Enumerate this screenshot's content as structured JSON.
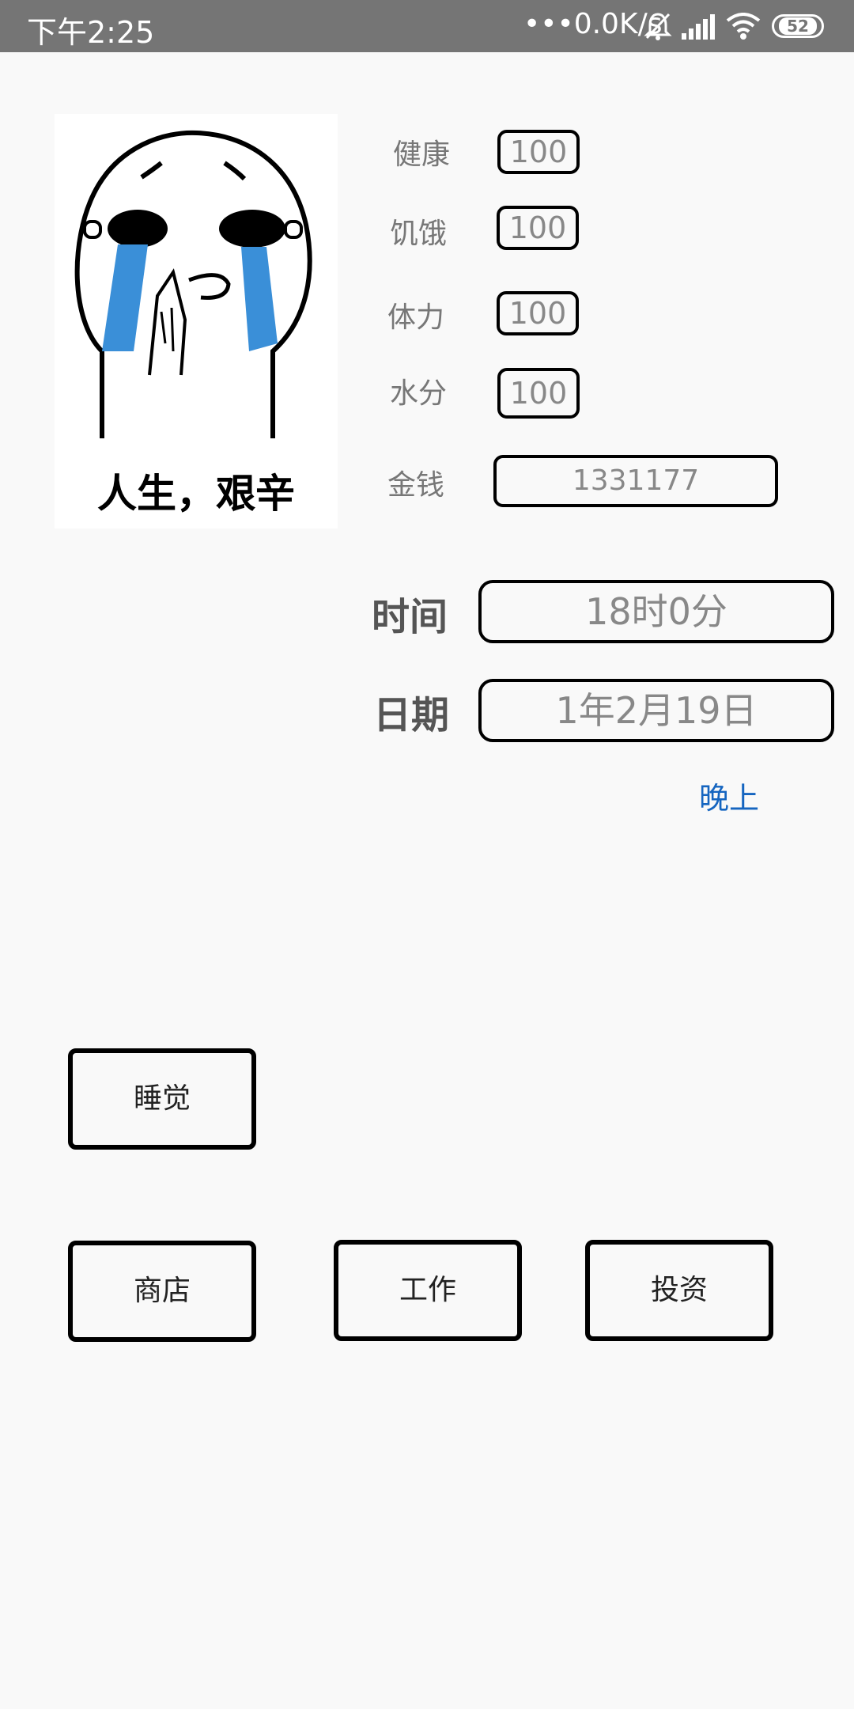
{
  "status_bar": {
    "time": "下午2:25",
    "network_speed": "•••0.0K/s",
    "battery": "52",
    "icons": [
      "bell-muted-icon",
      "signal-icon",
      "wifi-icon",
      "battery-icon"
    ]
  },
  "image": {
    "caption": "人生，艰辛"
  },
  "stats": {
    "health": {
      "label": "健康",
      "value": "100"
    },
    "hunger": {
      "label": "饥饿",
      "value": "100"
    },
    "stamina": {
      "label": "体力",
      "value": "100"
    },
    "water": {
      "label": "水分",
      "value": "100"
    },
    "money": {
      "label": "金钱",
      "value": "1331177"
    }
  },
  "time": {
    "label": "时间",
    "value": "18时0分"
  },
  "date": {
    "label": "日期",
    "value": "1年2月19日"
  },
  "period": "晚上",
  "buttons": {
    "sleep": "睡觉",
    "shop": "商店",
    "work": "工作",
    "invest": "投资"
  },
  "colors": {
    "background": "#f9f9f9",
    "status_bar": "#757575",
    "period_text": "#1565c0"
  }
}
